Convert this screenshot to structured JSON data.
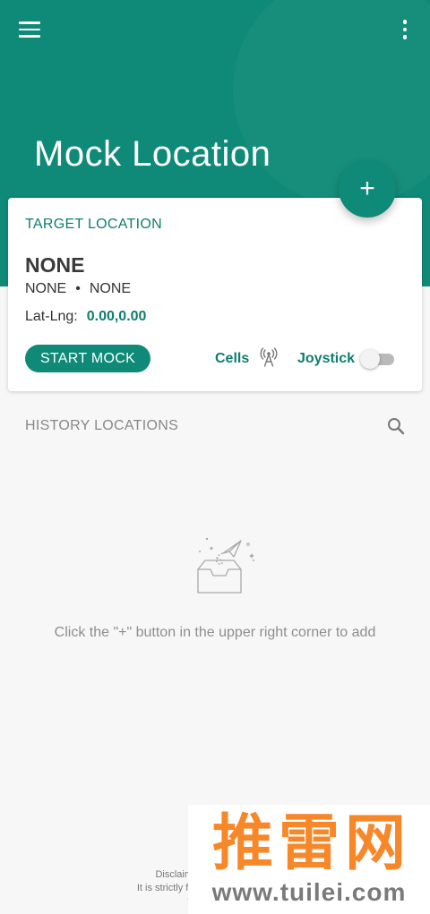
{
  "app": {
    "title": "Mock Location",
    "primary_color": "#0f8a78",
    "accent_text_color": "#0f7e6d",
    "menu_icon": "menu-icon",
    "more_icon": "more-vert-icon"
  },
  "fab": {
    "label": "+",
    "icon": "add-icon"
  },
  "target": {
    "section_label": "TARGET LOCATION",
    "name": "NONE",
    "sub_left": "NONE",
    "sub_sep": "•",
    "sub_right": "NONE",
    "latlng_label": "Lat-Lng:",
    "latlng_value": "0.00,0.00",
    "start_button": "START MOCK",
    "cells_label": "Cells",
    "cells_icon": "antenna-icon",
    "joystick_label": "Joystick",
    "joystick_enabled": false
  },
  "history": {
    "title": "HISTORY LOCATIONS",
    "search_icon": "search-icon",
    "empty_icon": "empty-inbox-icon",
    "empty_text": "Click the \"+\" button in the upper right corner to add"
  },
  "disclaimer": {
    "line1": "Disclaimer: This program is",
    "line2": "It is strictly forbidden to use it for ille",
    "line3": "this program"
  },
  "watermark": {
    "logo_text": "推雷网",
    "url": "www.tuilei.com",
    "color": "#f7882a"
  }
}
